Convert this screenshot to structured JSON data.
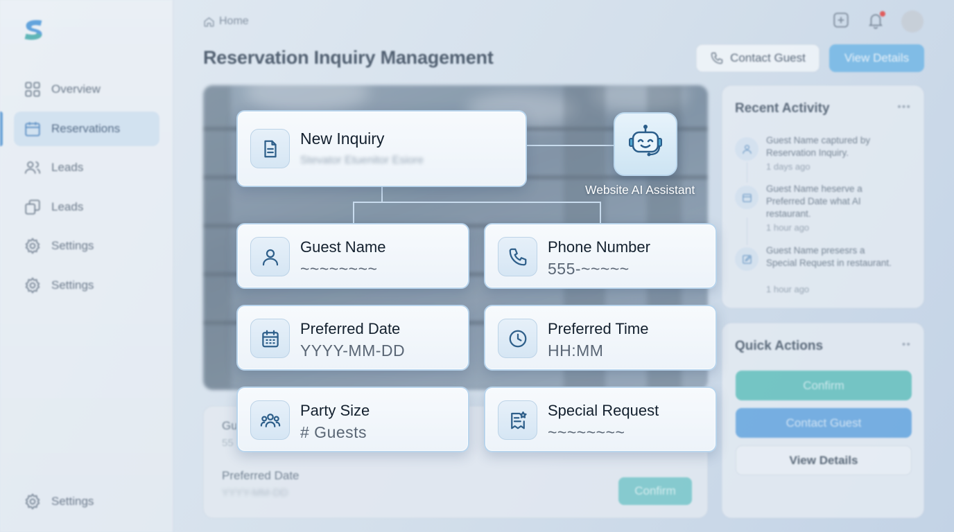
{
  "sidebar": {
    "items": [
      {
        "label": "Overview",
        "icon": "grid-icon"
      },
      {
        "label": "Reservations",
        "icon": "calendar-icon"
      },
      {
        "label": "Leads",
        "icon": "users-icon"
      },
      {
        "label": "Leads",
        "icon": "copy-icon"
      },
      {
        "label": "Settings",
        "icon": "gear-icon"
      },
      {
        "label": "Settings",
        "icon": "gear-icon"
      }
    ],
    "active_index": 1,
    "bottom_item": {
      "label": "Settings",
      "icon": "gear-icon"
    }
  },
  "header": {
    "breadcrumb": "Home",
    "title": "Reservation Inquiry Management",
    "contact_button": "Contact Guest",
    "view_button": "View Details",
    "has_notification": true
  },
  "inquiry": {
    "title": "New Inquiry",
    "subtitle_blurred": "Stevator Etuenitor Esiore",
    "assistant_label": "Website AI Assistant"
  },
  "fields": [
    {
      "label": "Guest Name",
      "value": "~~~~~~~~",
      "icon": "user-icon"
    },
    {
      "label": "Phone Number",
      "value": "555-~~~~~",
      "icon": "phone-icon"
    },
    {
      "label": "Preferred Date",
      "value": "YYYY-MM-DD",
      "icon": "calendar-icon"
    },
    {
      "label": "Preferred Time",
      "value": "HH:MM",
      "icon": "clock-icon"
    },
    {
      "label": "Party Size",
      "value": "# Guests",
      "icon": "group-icon"
    },
    {
      "label": "Special Request",
      "value": "~~~~~~~~",
      "icon": "star-note-icon"
    }
  ],
  "background_form": {
    "field_a_label": "Gu",
    "field_a_value": "55",
    "field_b_label": "Preferred Date",
    "field_b_value": "YYYY-MM-DD",
    "confirm_button": "Confirm"
  },
  "recent_activity": {
    "title": "Recent Activity",
    "more": "•••",
    "items": [
      {
        "text": "Guest Name captured by Reservation Inquiry.",
        "time": "1 days ago",
        "icon": "user-icon"
      },
      {
        "text": "Guest Name heserve a Preferred Date what AI restaurant.",
        "time": "1 hour ago",
        "icon": "calendar-icon"
      },
      {
        "text": "Guest Name presesrs a Special Request in restaurant.",
        "time": "1 hour ago",
        "icon": "edit-icon"
      }
    ]
  },
  "quick_actions": {
    "title": "Quick Actions",
    "more": "••",
    "confirm": "Confirm",
    "contact": "Contact Guest",
    "view": "View Details"
  },
  "colors": {
    "accent_blue": "#5fa3df",
    "accent_teal": "#5cbfba",
    "notification": "#e53935"
  }
}
